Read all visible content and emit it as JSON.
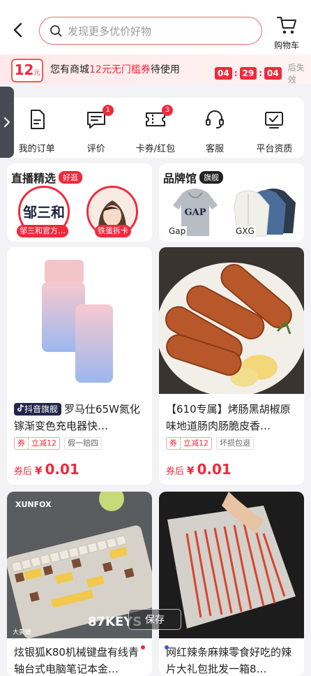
{
  "header": {
    "search_placeholder": "发现更多优价好物",
    "cart_label": "购物车"
  },
  "coupon_bar": {
    "badge_amount": "12",
    "badge_unit": "元",
    "text_prefix": "您有商城",
    "text_highlight": "12元无门槛券",
    "text_suffix": "待使用",
    "timer_h": "04",
    "timer_m": "29",
    "timer_s": "04",
    "timer_after": "后失效"
  },
  "quick_nav": [
    {
      "label": "我的订单",
      "icon": "order-icon",
      "badge": ""
    },
    {
      "label": "评价",
      "icon": "comment-icon",
      "badge": "1"
    },
    {
      "label": "卡券/红包",
      "icon": "ticket-icon",
      "badge": "3"
    },
    {
      "label": "客服",
      "icon": "headset-icon",
      "badge": ""
    },
    {
      "label": "平台资质",
      "icon": "certificate-icon",
      "badge": ""
    }
  ],
  "live": {
    "title": "直播精选",
    "tag": "好逛",
    "streamers": [
      {
        "name": "邹三和官方…",
        "avatar_text": "邹三和"
      },
      {
        "name": "铁蛋拆卡"
      }
    ]
  },
  "brand": {
    "title": "品牌馆",
    "tag": "旗舰",
    "brands": [
      {
        "name": "Gap",
        "print": "GAP"
      },
      {
        "name": "GXG"
      }
    ]
  },
  "products": [
    {
      "store_tag": "抖音旗舰",
      "title": "罗马仕65W氮化镓渐变色充电器快…",
      "coupon_a": "券",
      "coupon_b": "立减12",
      "gray_tag": "假一赔四",
      "price_prefix": "券后",
      "currency": "¥",
      "price": "0.01"
    },
    {
      "store_tag": "",
      "title": "【610专属】烤肠黑胡椒原味地道肠肉肠脆皮香…",
      "coupon_a": "券",
      "coupon_b": "立减12",
      "gray_tag": "坏损包退",
      "price_prefix": "券后",
      "currency": "¥",
      "price": "0.01"
    },
    {
      "title": "炫银狐K80机械键盘有线青轴台式电脑笔记本金…",
      "img_brand": "XUNFOX",
      "img_keys": "87KEYS",
      "img_corner": "大黄蜂"
    },
    {
      "title": "网红辣条麻辣零食好吃的辣片大礼包批发一箱8…"
    }
  ],
  "save_button": "保存",
  "colors": {
    "accent": "#f0293c",
    "store_tag_bg": "#22264a"
  }
}
